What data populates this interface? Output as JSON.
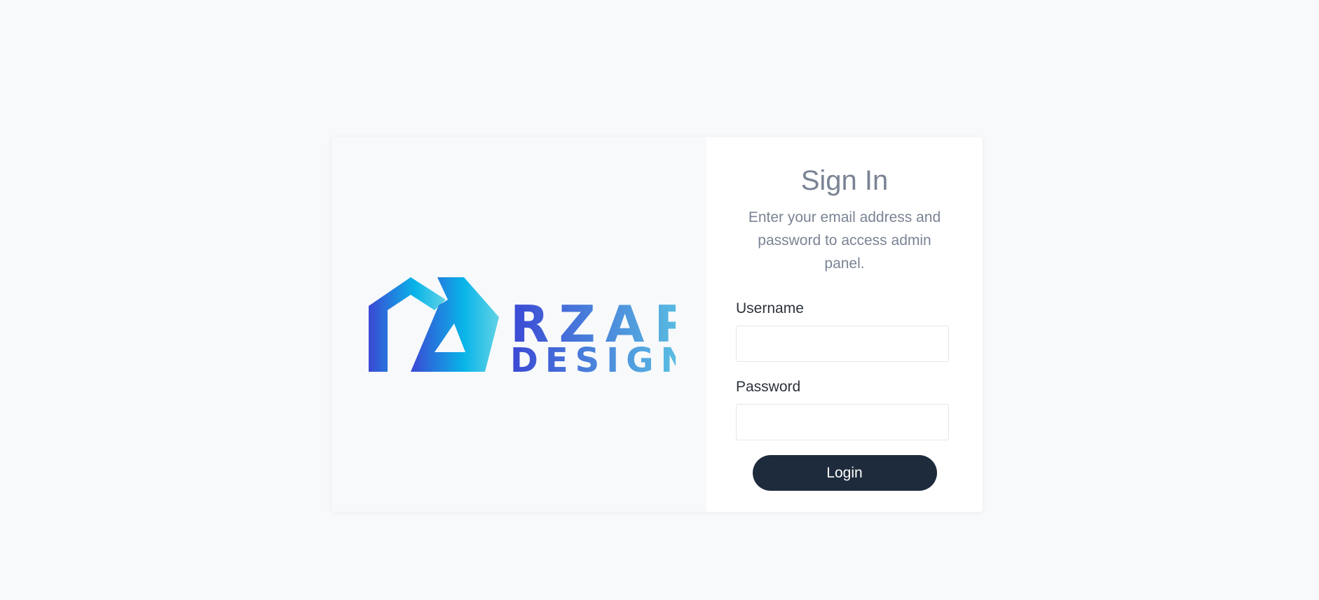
{
  "brand": {
    "logo_line1": "RZAP",
    "logo_line2": "DESIGN",
    "gradient_start": "#3a4bd6",
    "gradient_mid": "#0bb0e6",
    "gradient_end": "#5fd2e6"
  },
  "signin": {
    "title": "Sign In",
    "subtitle": "Enter your email address and password to access admin panel.",
    "username_label": "Username",
    "username_value": "",
    "password_label": "Password",
    "password_value": "",
    "login_label": "Login",
    "button_color": "#1e2b3c"
  }
}
